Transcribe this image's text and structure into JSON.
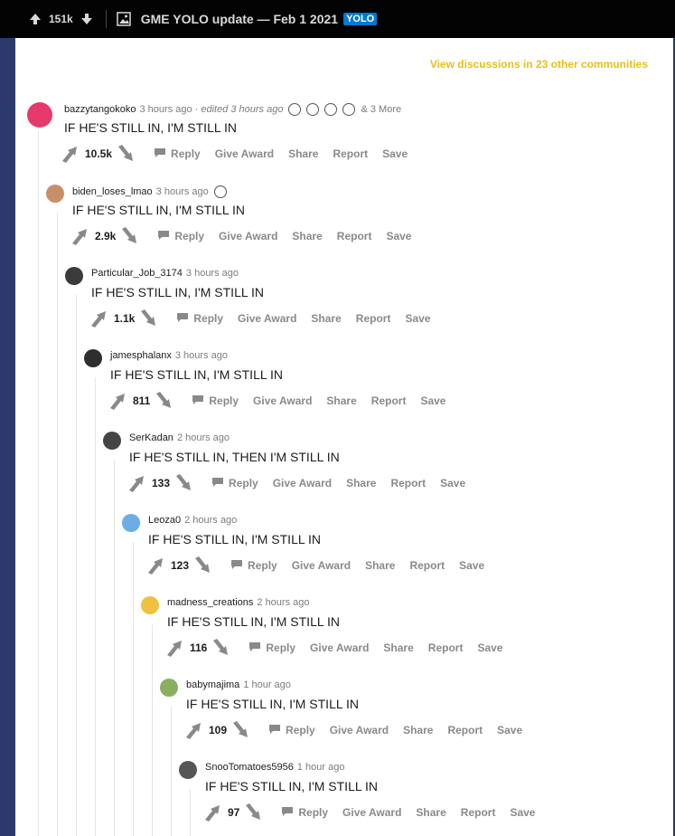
{
  "topbar": {
    "score": "151k",
    "title": "GME YOLO update — Feb 1 2021",
    "flair": "YOLO"
  },
  "discussions_link": "View discussions in 23 other communities",
  "actions": {
    "reply": "Reply",
    "give_award": "Give Award",
    "share": "Share",
    "report": "Report",
    "save": "Save"
  },
  "comments": [
    {
      "user": "bazzytangokoko",
      "time": "3 hours ago",
      "edited": "· edited 3 hours ago",
      "more": "& 3 More",
      "text": "IF HE'S STILL IN, I'M STILL IN",
      "score": "10.5k"
    },
    {
      "user": "biden_loses_lmao",
      "time": "3 hours ago",
      "text": "IF HE'S STILL IN, I'M STILL IN",
      "score": "2.9k"
    },
    {
      "user": "Particular_Job_3174",
      "time": "3 hours ago",
      "text": "IF HE'S STILL IN, I'M STILL IN",
      "score": "1.1k"
    },
    {
      "user": "jamesphalanx",
      "time": "3 hours ago",
      "text": "IF HE'S STILL IN, I'M STILL IN",
      "score": "811"
    },
    {
      "user": "SerKadan",
      "time": "2 hours ago",
      "text": "IF HE'S STILL IN, THEN I'M STILL IN",
      "score": "133"
    },
    {
      "user": "Leoza0",
      "time": "2 hours ago",
      "text": "IF HE'S STILL IN, I'M STILL IN",
      "score": "123"
    },
    {
      "user": "madness_creations",
      "time": "2 hours ago",
      "text": "IF HE'S STILL IN, I'M STILL IN",
      "score": "116"
    },
    {
      "user": "babymajima",
      "time": "1 hour ago",
      "text": "IF HE'S STILL IN, I'M STILL IN",
      "score": "109"
    },
    {
      "user": "SnooTomatoes5956",
      "time": "1 hour ago",
      "text": "IF HE'S STILL IN, I'M STILL IN",
      "score": "97"
    }
  ]
}
